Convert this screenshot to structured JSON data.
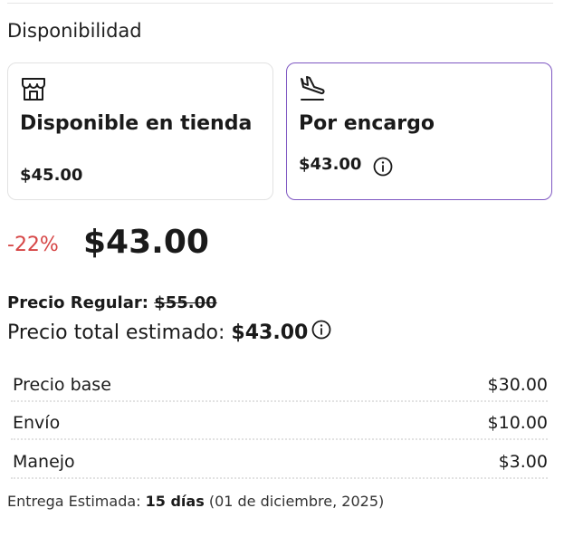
{
  "availability": {
    "title": "Disponibilidad",
    "options": [
      {
        "icon": "store-icon",
        "label": "Disponible en tienda",
        "price": "$45.00",
        "selected": false
      },
      {
        "icon": "plane-landing-icon",
        "label": "Por encargo",
        "price": "$43.00",
        "selected": true
      }
    ]
  },
  "pricing": {
    "discount": "-22%",
    "price": "$43.00",
    "regular_label": "Precio Regular:",
    "regular_price": "$55.00",
    "total_label": "Precio total estimado:",
    "total_price": "$43.00"
  },
  "breakdown": [
    {
      "label": "Precio base",
      "value": "$30.00"
    },
    {
      "label": "Envío",
      "value": "$10.00"
    },
    {
      "label": "Manejo",
      "value": "$3.00"
    }
  ],
  "delivery": {
    "label": "Entrega Estimada:",
    "days": "15 días",
    "date": "(01 de diciembre, 2025)"
  },
  "colors": {
    "accent": "#7e57c2",
    "discount": "#d64545",
    "border": "#e2e2e2"
  }
}
